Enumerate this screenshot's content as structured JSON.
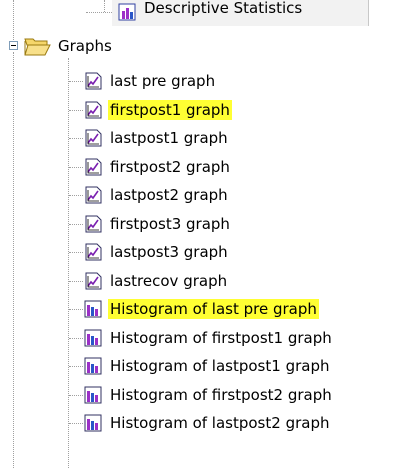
{
  "top_item": {
    "label": "Descriptive Statistics",
    "icon": "table-icon"
  },
  "folder": {
    "label": "Graphs",
    "icon": "folder-open-icon",
    "expander": "minus"
  },
  "items": [
    {
      "label": "last pre graph",
      "icon": "line-graph-icon",
      "highlighted": false
    },
    {
      "label": "firstpost1 graph",
      "icon": "line-graph-icon",
      "highlighted": true
    },
    {
      "label": "lastpost1 graph",
      "icon": "line-graph-icon",
      "highlighted": false
    },
    {
      "label": "firstpost2 graph",
      "icon": "line-graph-icon",
      "highlighted": false
    },
    {
      "label": "lastpost2 graph",
      "icon": "line-graph-icon",
      "highlighted": false
    },
    {
      "label": "firstpost3 graph",
      "icon": "line-graph-icon",
      "highlighted": false
    },
    {
      "label": "lastpost3 graph",
      "icon": "line-graph-icon",
      "highlighted": false
    },
    {
      "label": "lastrecov graph",
      "icon": "line-graph-icon",
      "highlighted": false
    },
    {
      "label": "Histogram of last pre graph",
      "icon": "histogram-icon",
      "highlighted": true
    },
    {
      "label": "Histogram of firstpost1 graph",
      "icon": "histogram-icon",
      "highlighted": false
    },
    {
      "label": "Histogram of lastpost1 graph",
      "icon": "histogram-icon",
      "highlighted": false
    },
    {
      "label": "Histogram of firstpost2 graph",
      "icon": "histogram-icon",
      "highlighted": false
    },
    {
      "label": "Histogram of lastpost2 graph",
      "icon": "histogram-icon",
      "highlighted": false
    }
  ],
  "colors": {
    "highlight": "#ffff33",
    "bar_purple": "#9b30c8",
    "bar_blue": "#2a55c8",
    "line_purple": "#7a1fb0"
  }
}
